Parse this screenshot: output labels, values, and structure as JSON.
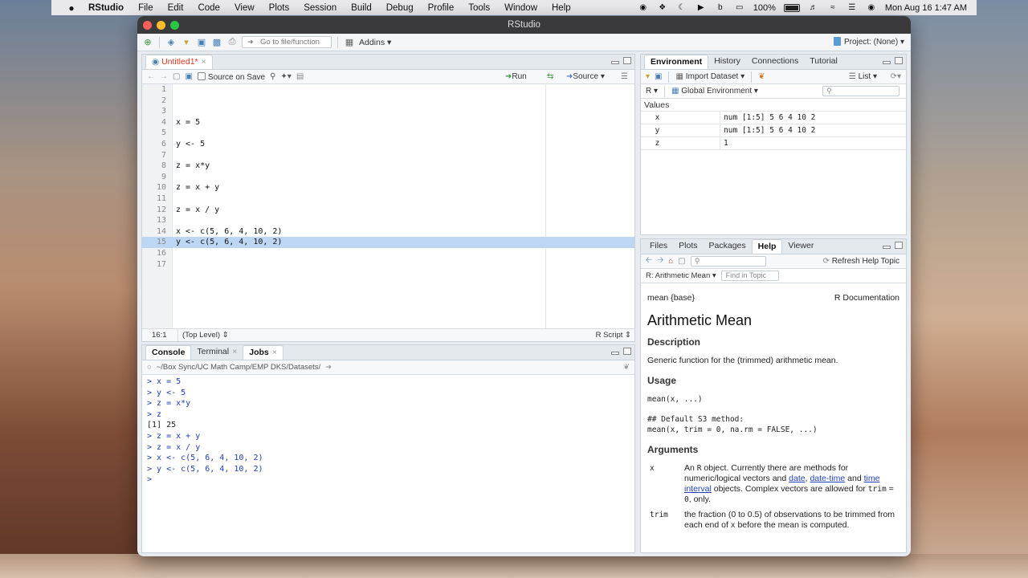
{
  "menubar": {
    "app": "RStudio",
    "items": [
      "File",
      "Edit",
      "Code",
      "View",
      "Plots",
      "Session",
      "Build",
      "Debug",
      "Profile",
      "Tools",
      "Window",
      "Help"
    ],
    "battery": "100%",
    "datetime": "Mon Aug 16  1:47 AM"
  },
  "window": {
    "title": "RStudio",
    "goto_placeholder": "Go to file/function",
    "addins": "Addins",
    "project": "Project: (None)"
  },
  "editor": {
    "tab": "Untitled1*",
    "source_on_save": "Source on Save",
    "run": "Run",
    "source": "Source",
    "lines": [
      {
        "n": "1",
        "t": ""
      },
      {
        "n": "2",
        "t": ""
      },
      {
        "n": "3",
        "t": ""
      },
      {
        "n": "4",
        "t": "x = 5"
      },
      {
        "n": "5",
        "t": ""
      },
      {
        "n": "6",
        "t": "y <- 5"
      },
      {
        "n": "7",
        "t": ""
      },
      {
        "n": "8",
        "t": "z = x*y"
      },
      {
        "n": "9",
        "t": ""
      },
      {
        "n": "10",
        "t": "z = x + y"
      },
      {
        "n": "11",
        "t": ""
      },
      {
        "n": "12",
        "t": "z = x / y"
      },
      {
        "n": "13",
        "t": ""
      },
      {
        "n": "14",
        "t": "x <- c(5, 6, 4, 10, 2)"
      },
      {
        "n": "15",
        "t": "y <- c(5, 6, 4, 10, 2)"
      },
      {
        "n": "16",
        "t": ""
      },
      {
        "n": "17",
        "t": ""
      }
    ],
    "selected_line": 15,
    "cursor_pos": "16:1",
    "scope": "(Top Level)",
    "filetype": "R Script"
  },
  "console": {
    "tabs": [
      "Console",
      "Terminal",
      "Jobs"
    ],
    "path": "~/Box Sync/UC Math Camp/EMP DKS/Datasets/",
    "lines": [
      {
        "type": "cmd",
        "t": "> x = 5"
      },
      {
        "type": "cmd",
        "t": "> y <- 5"
      },
      {
        "type": "cmd",
        "t": "> z = x*y"
      },
      {
        "type": "cmd",
        "t": "> z"
      },
      {
        "type": "out",
        "t": "[1] 25"
      },
      {
        "type": "cmd",
        "t": "> z = x + y"
      },
      {
        "type": "cmd",
        "t": "> z = x / y"
      },
      {
        "type": "cmd",
        "t": "> x <- c(5, 6, 4, 10, 2)"
      },
      {
        "type": "cmd",
        "t": "> y <- c(5, 6, 4, 10, 2)"
      },
      {
        "type": "cmd",
        "t": "> "
      }
    ]
  },
  "environment": {
    "tabs": [
      "Environment",
      "History",
      "Connections",
      "Tutorial"
    ],
    "import": "Import Dataset",
    "list": "List",
    "lang": "R",
    "scope": "Global Environment",
    "section": "Values",
    "rows": [
      {
        "name": "x",
        "value": "num [1:5] 5 6 4 10 2"
      },
      {
        "name": "y",
        "value": "num [1:5] 5 6 4 10 2"
      },
      {
        "name": "z",
        "value": "1"
      }
    ]
  },
  "help": {
    "tabs": [
      "Files",
      "Plots",
      "Packages",
      "Help",
      "Viewer"
    ],
    "refresh": "Refresh Help Topic",
    "topic": "R: Arithmetic Mean",
    "find_placeholder": "Find in Topic",
    "pkg": "mean {base}",
    "doc": "R Documentation",
    "title": "Arithmetic Mean",
    "description_h": "Description",
    "description": "Generic function for the (trimmed) arithmetic mean.",
    "usage_h": "Usage",
    "usage1": "mean(x, ...)",
    "usage2": "## Default S3 method:",
    "usage3": "mean(x, trim = 0, na.rm = FALSE, ...)",
    "arguments_h": "Arguments",
    "arg_x": "x",
    "arg_x_1": "An ",
    "arg_x_R": "R",
    "arg_x_2": " object. Currently there are methods for numeric/logical vectors and ",
    "link_date": "date",
    "comma1": ", ",
    "link_datetime": "date-time",
    "and": " and ",
    "link_time": "time interval",
    "arg_x_3": " objects. Complex vectors are allowed for ",
    "arg_x_trim": "trim",
    "arg_x_4": " = ",
    "arg_x_zero": "0",
    "arg_x_5": ", only.",
    "arg_trim": "trim",
    "arg_trim_1": "the fraction (0 to 0.5) of observations to be trimmed from each end of ",
    "arg_trim_x": "x",
    "arg_trim_2": " before the mean is computed."
  }
}
